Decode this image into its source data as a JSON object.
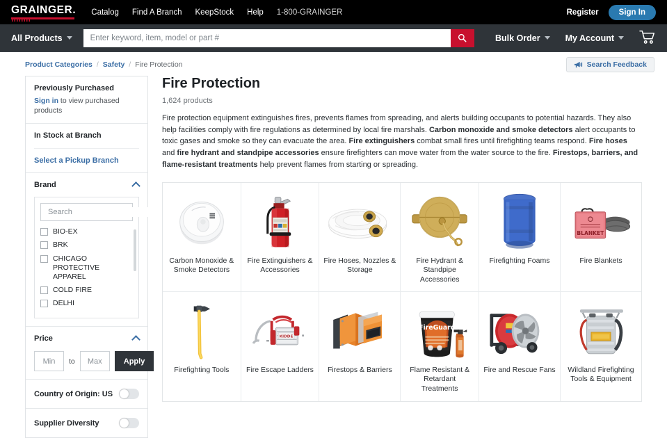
{
  "header": {
    "logo_text": "GRAINGER",
    "nav": [
      {
        "label": "Catalog"
      },
      {
        "label": "Find A Branch"
      },
      {
        "label": "KeepStock"
      },
      {
        "label": "Help"
      }
    ],
    "phone": "1-800-GRAINGER",
    "register_label": "Register",
    "signin_label": "Sign In"
  },
  "searchbar": {
    "all_products_label": "All Products",
    "placeholder": "Enter keyword, item, model or part #",
    "value": "",
    "bulk_order_label": "Bulk Order",
    "my_account_label": "My Account",
    "accent_red": "#c8102e"
  },
  "breadcrumb": {
    "items": [
      {
        "label": "Product Categories"
      },
      {
        "label": "Safety"
      },
      {
        "label": "Fire Protection"
      }
    ],
    "separator": "/",
    "feedback_label": "Search Feedback"
  },
  "sidebar": {
    "previously_purchased": {
      "title": "Previously Purchased",
      "signin_link": "Sign in",
      "rest_text": " to view purchased products"
    },
    "in_stock": {
      "title": "In Stock at Branch",
      "pickup_link": "Select a Pickup Branch"
    },
    "brand": {
      "title": "Brand",
      "search_placeholder": "Search",
      "search_value": "",
      "items": [
        {
          "label": "BIO-EX",
          "checked": false
        },
        {
          "label": "BRK",
          "checked": false
        },
        {
          "label": "CHICAGO PROTECTIVE APPAREL",
          "checked": false
        },
        {
          "label": "COLD FIRE",
          "checked": false
        },
        {
          "label": "DELHI",
          "checked": false
        }
      ]
    },
    "price": {
      "title": "Price",
      "min_placeholder": "Min",
      "min_value": "",
      "to_label": "to",
      "max_placeholder": "Max",
      "max_value": "",
      "apply_label": "Apply"
    },
    "toggles": [
      {
        "label": "Country of Origin: US",
        "on": false
      },
      {
        "label": "Supplier Diversity",
        "on": false
      }
    ]
  },
  "main": {
    "title": "Fire Protection",
    "product_count": "1,624 products",
    "description_parts": [
      {
        "text": "Fire protection equipment extinguishes fires, prevents flames from spreading, and alerts building occupants to potential hazards. They also help facilities comply with fire regulations as determined by local fire marshals. ",
        "bold": false
      },
      {
        "text": "Carbon monoxide and smoke detectors",
        "bold": true
      },
      {
        "text": " alert occupants to toxic gases and smoke so they can evacuate the area. ",
        "bold": false
      },
      {
        "text": "Fire extinguishers",
        "bold": true
      },
      {
        "text": " combat small fires until firefighting teams respond. ",
        "bold": false
      },
      {
        "text": "Fire hoses",
        "bold": true
      },
      {
        "text": " and ",
        "bold": false
      },
      {
        "text": "fire hydrant and standpipe accessories",
        "bold": true
      },
      {
        "text": " ensure firefighters can move water from the water source to the fire. ",
        "bold": false
      },
      {
        "text": "Firestops, barriers, and flame-resistant treatments",
        "bold": true
      },
      {
        "text": " help prevent flames from starting or spreading.",
        "bold": false
      }
    ],
    "categories": [
      {
        "label": "Carbon Monoxide & Smoke Detectors",
        "image": "smoke-detector"
      },
      {
        "label": "Fire Extinguishers & Accessories",
        "image": "fire-extinguisher"
      },
      {
        "label": "Fire Hoses, Nozzles & Storage",
        "image": "fire-hose"
      },
      {
        "label": "Fire Hydrant & Standpipe Accessories",
        "image": "hydrant-cap"
      },
      {
        "label": "Firefighting Foams",
        "image": "blue-drum"
      },
      {
        "label": "Fire Blankets",
        "image": "fire-blanket"
      },
      {
        "label": "Firefighting Tools",
        "image": "fire-axe"
      },
      {
        "label": "Fire Escape Ladders",
        "image": "escape-ladder"
      },
      {
        "label": "Firestops & Barriers",
        "image": "firestop-block"
      },
      {
        "label": "Flame Resistant & Retardant Treatments",
        "image": "fireguard-bucket"
      },
      {
        "label": "Fire and Rescue Fans",
        "image": "rescue-fan"
      },
      {
        "label": "Wildland Firefighting Tools & Equipment",
        "image": "backpack-pump"
      }
    ]
  }
}
